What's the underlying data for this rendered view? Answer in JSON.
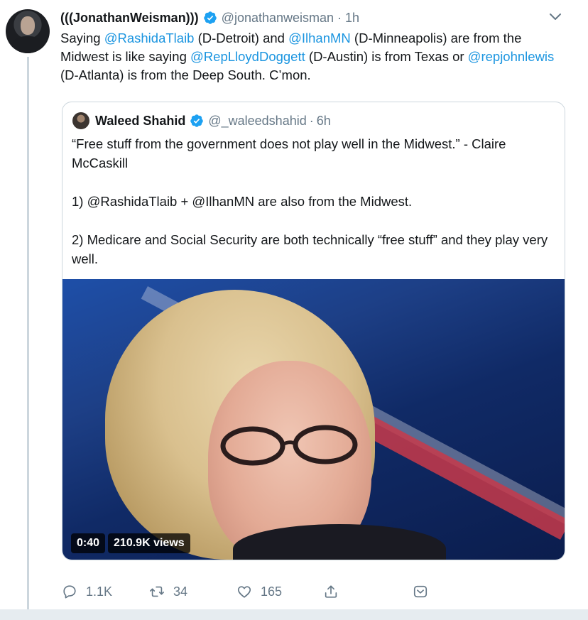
{
  "tweet": {
    "author_name": "(((JonathanWeisman)))",
    "author_handle": "@jonathanweisman",
    "time": "1h",
    "text_parts": [
      "Saying ",
      "@RashidaTlaib",
      " (D-Detroit) and ",
      "@IlhanMN",
      " (D-Minneapolis) are from the Midwest is like saying ",
      "@RepLloydDoggett",
      " (D-Austin) is from Texas or ",
      "@repjohnlewis",
      " (D-Atlanta) is from the Deep South. C’mon."
    ]
  },
  "quote": {
    "author_name": "Waleed Shahid",
    "author_handle": "@_waleedshahid",
    "time": "6h",
    "paragraphs": [
      "“Free stuff from the government does not play well in the Midwest.” - Claire McCaskill",
      "1) @RashidaTlaib + @IlhanMN are also from the Midwest.",
      "2) Medicare and Social Security are both technically “free stuff” and they play very well."
    ],
    "video": {
      "duration": "0:40",
      "views": "210.9K views"
    }
  },
  "actions": {
    "replies": "1.1K",
    "retweets": "34",
    "likes": "165"
  },
  "colors": {
    "link": "#1b95e0",
    "secondary_text": "#657786",
    "verified": "#1da1f2",
    "border": "#ccd6dd"
  },
  "icons": [
    "verified-badge-icon",
    "chevron-down-icon",
    "reply-icon",
    "retweet-icon",
    "like-icon",
    "share-icon",
    "message-icon"
  ]
}
